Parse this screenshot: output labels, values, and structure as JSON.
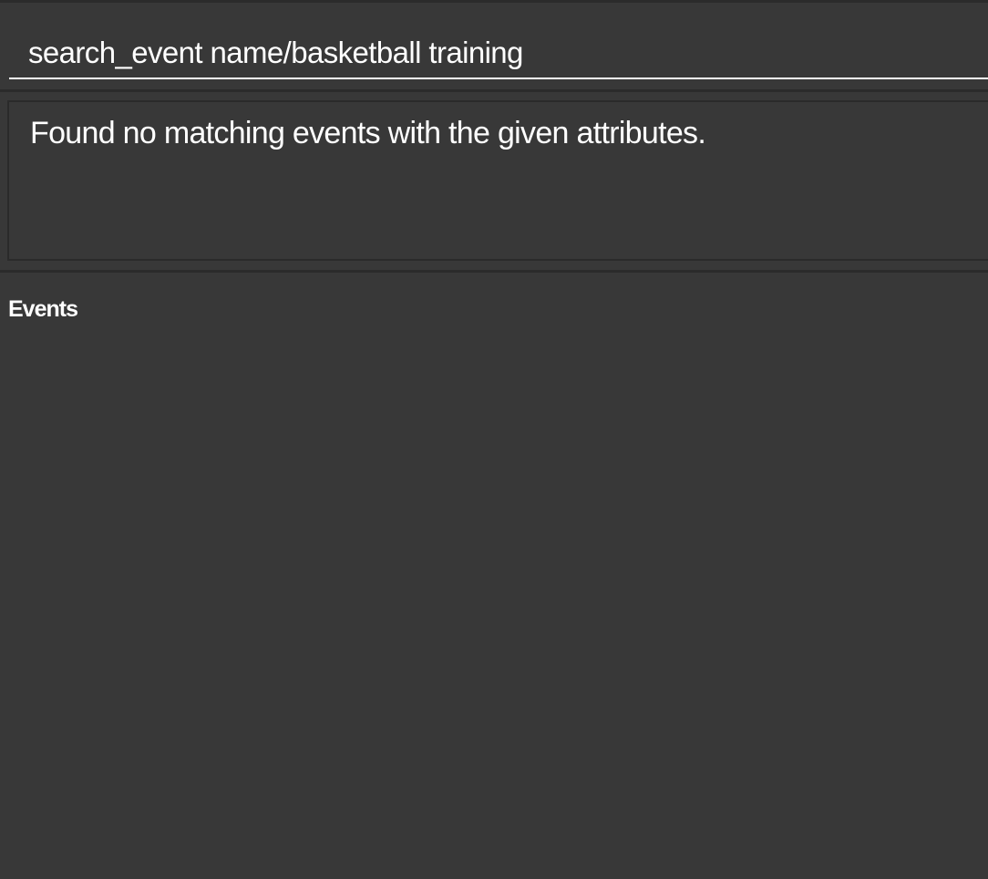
{
  "command_box": {
    "value": "search_event name/basketball training"
  },
  "result_display": {
    "text": "Found no matching events with the given attributes."
  },
  "event_panel": {
    "title": "Events",
    "items": []
  },
  "colors": {
    "background": "#383838",
    "border": "#2b2b2b",
    "text": "#ffffff",
    "underline": "#ffffff"
  }
}
